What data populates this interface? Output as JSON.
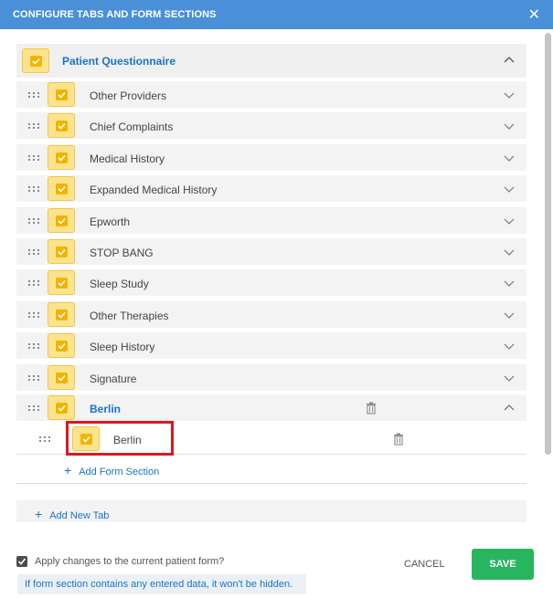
{
  "header": {
    "title": "CONFIGURE TABS AND FORM SECTIONS",
    "close_icon": "close-icon"
  },
  "parent": {
    "label": "Patient Questionnaire",
    "checked": true
  },
  "sections": [
    {
      "label": "Other Providers"
    },
    {
      "label": "Chief Complaints"
    },
    {
      "label": "Medical History"
    },
    {
      "label": "Expanded Medical History"
    },
    {
      "label": "Epworth"
    },
    {
      "label": "STOP BANG"
    },
    {
      "label": "Sleep Study"
    },
    {
      "label": "Other Therapies"
    },
    {
      "label": "Sleep History"
    },
    {
      "label": "Signature"
    }
  ],
  "expanded_section": {
    "label": "Berlin",
    "child_label": "Berlin"
  },
  "actions": {
    "add_form_section": "Add Form Section",
    "add_new_tab": "Add New Tab"
  },
  "footer": {
    "apply_label": "Apply changes to the current patient form?",
    "apply_checked": true,
    "note": "If form section contains any entered data, it won't be hidden.",
    "cancel_label": "CANCEL",
    "save_label": "SAVE"
  },
  "colors": {
    "header_bg": "#4a90d9",
    "checkbox_bg": "#fde38d",
    "checkbox_check": "#f1b400",
    "link_blue": "#1a73c9",
    "save_green": "#28b560",
    "highlight_red": "#e0161c"
  }
}
